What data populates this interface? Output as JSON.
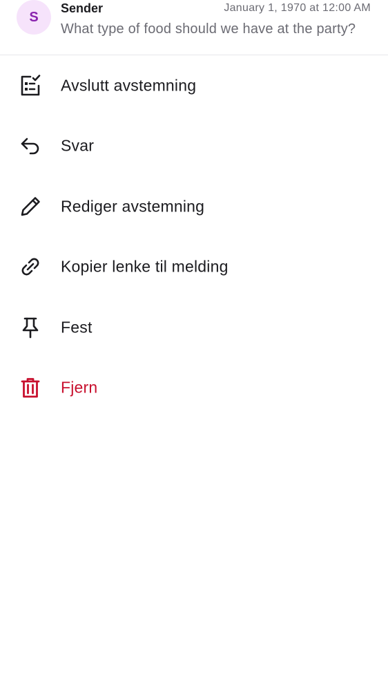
{
  "message": {
    "avatar_initial": "S",
    "sender": "Sender",
    "timestamp": "January 1, 1970 at 12:00 AM",
    "preview": "What type of food should we have at the party?"
  },
  "menu": {
    "items": [
      {
        "label": "Avslutt avstemning",
        "icon": "end-poll-icon"
      },
      {
        "label": "Svar",
        "icon": "reply-icon"
      },
      {
        "label": "Rediger avstemning",
        "icon": "pencil-icon"
      },
      {
        "label": "Kopier lenke til melding",
        "icon": "link-icon"
      },
      {
        "label": "Fest",
        "icon": "pin-icon"
      },
      {
        "label": "Fjern",
        "icon": "trash-icon"
      }
    ]
  },
  "colors": {
    "avatar_bg": "#f6e3fb",
    "avatar_fg": "#8a24ae",
    "text_primary": "#1b1b1f",
    "text_secondary": "#6b6b73",
    "danger": "#c8102e"
  }
}
